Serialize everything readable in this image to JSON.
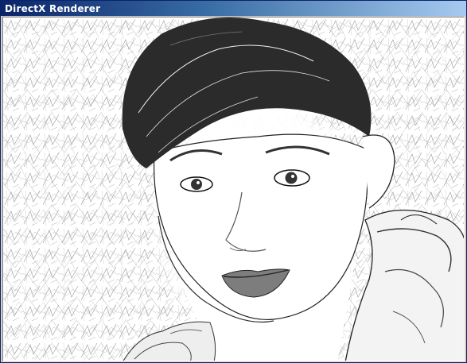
{
  "window": {
    "title": "DirectX Renderer"
  },
  "viewport": {
    "content": "rendered-frame",
    "colors": {
      "ink": "#1a1a1a",
      "paper": "#ffffff",
      "titlebar_start": "#0a246a",
      "titlebar_end": "#a6caf0"
    }
  }
}
